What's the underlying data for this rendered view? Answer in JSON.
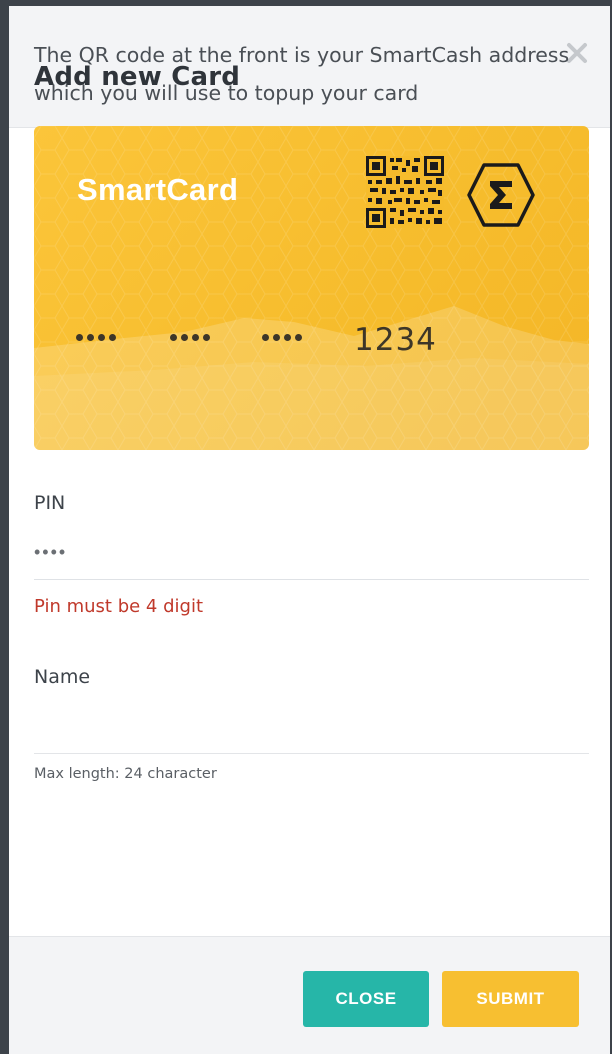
{
  "modal": {
    "title": "Add new Card",
    "close_icon": "close-icon"
  },
  "intro_text": "The QR code at the front is your SmartCash address which you will use to topup your card",
  "card": {
    "brand": "SmartCard",
    "masked_groups": [
      "••••",
      "••••",
      "••••"
    ],
    "last_digits": "1234",
    "logo_icon": "smartcash-hex-logo-icon",
    "qr_icon": "qr-code-icon"
  },
  "form": {
    "pin_label": "PIN",
    "pin_value": "••••",
    "pin_error": "Pin must be 4 digit",
    "name_label": "Name",
    "name_value": "",
    "name_hint": "Max length: 24 character"
  },
  "footer": {
    "close_label": "CLOSE",
    "submit_label": "SUBMIT"
  },
  "colors": {
    "card_yellow": "#f6bc2c",
    "close_teal": "#26b6a8",
    "submit_yellow": "#f7bf31",
    "error_red": "#c0392b"
  }
}
